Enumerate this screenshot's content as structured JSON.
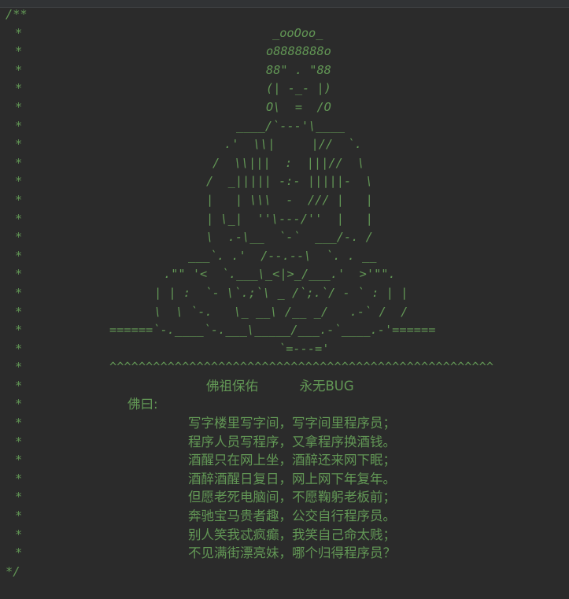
{
  "comment_open": "/**",
  "comment_close": "*/",
  "gutter_star": "*",
  "art_lines": [
    "_ooOoo_",
    "o8888888o",
    "88\" . \"88",
    "(| -_- |)",
    "O\\  =  /O",
    "____/`---'\\____",
    ".'  \\\\|     |//  `.",
    "/  \\\\|||  :  |||//  \\",
    "/  _||||| -:- |||||-  \\",
    "|   | \\\\\\  -  /// |   |",
    "| \\_|  ''\\---/''  |   |",
    "\\  .-\\__  `-`  ___/-. /",
    "___`. .'  /--.--\\  `. . __",
    ".\"\" '<  `.___\\_<|>_/___.'  >'\"\".",
    "| | :  `- \\`.;`\\ _ /`;.`/ - ` : | |",
    "\\  \\ `-.   \\_ __\\ /__ _/   .-` /  /",
    "======`-.____`-.___\\_____/___.-`____.-'======",
    "`=---='",
    "^^^^^^^^^^^^^^^^^^^^^^^^^^^^^^^^^^^^^^^^^^^^^^^^^^^^^"
  ],
  "blessing": "佛祖保佑          永无BUG",
  "buddha_said": "佛曰:",
  "poem": [
    "写字楼里写字间，写字间里程序员；",
    "程序人员写程序，又拿程序换酒钱。",
    "酒醒只在网上坐，酒醉还来网下眠；",
    "酒醉酒醒日复日，网上网下年复年。",
    "但愿老死电脑间，不愿鞠躬老板前；",
    "奔驰宝马贵者趣，公交自行程序员。",
    "别人笑我忒疯癫，我笑自己命太贱；",
    "不见满街漂亮妹，哪个归得程序员？"
  ]
}
